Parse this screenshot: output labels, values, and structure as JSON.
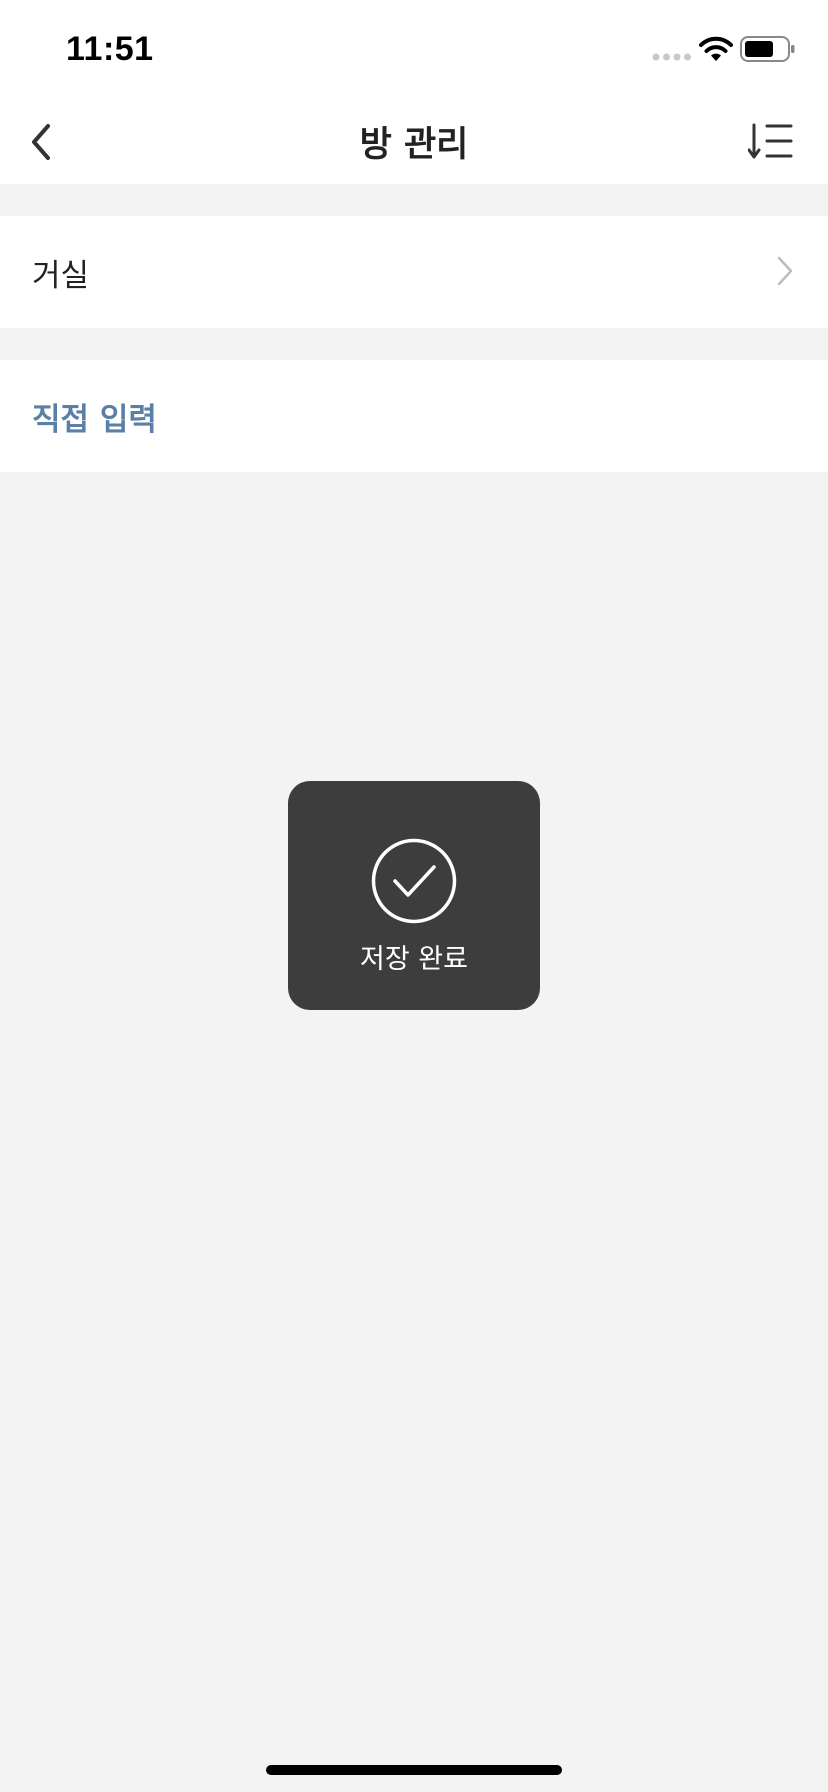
{
  "status_bar": {
    "time": "11:51",
    "icons": [
      "signal-dots-icon",
      "wifi-icon",
      "battery-icon"
    ]
  },
  "nav": {
    "title": "방 관리",
    "back_icon": "chevron-left-icon",
    "sort_icon": "sort-list-icon"
  },
  "rooms": [
    {
      "label": "거실",
      "icon": "chevron-right-icon"
    }
  ],
  "direct_input": {
    "label": "직접 입력",
    "color": "#5b7fa6"
  },
  "toast": {
    "message": "저장 완료",
    "icon": "check-circle-icon",
    "background": "#3d3d3d"
  },
  "colors": {
    "background": "#f3f3f3",
    "surface": "#ffffff",
    "text": "#222222"
  }
}
